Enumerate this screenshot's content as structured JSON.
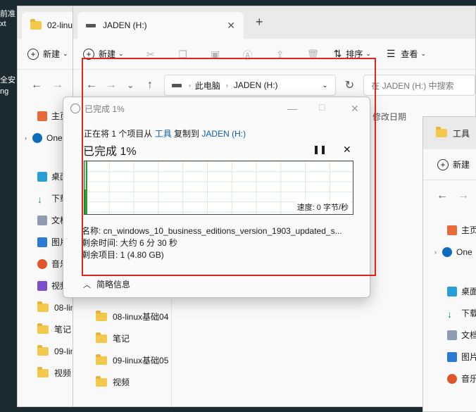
{
  "desktop": {
    "lines": [
      "前准",
      "xt",
      "",
      "",
      "",
      "",
      "",
      "",
      "",
      "",
      "全安",
      "ng"
    ]
  },
  "win_left": {
    "tab_title": "02-linu",
    "new_label": "新建",
    "sidebar": [
      {
        "label": "主页",
        "icon": "home-icon"
      },
      {
        "label": "One",
        "icon": "cloud-icon"
      },
      {
        "label": "桌面",
        "icon": "desktop-icon"
      },
      {
        "label": "下载",
        "icon": "download-icon"
      },
      {
        "label": "文档",
        "icon": "document-icon"
      },
      {
        "label": "图片",
        "icon": "image-icon"
      },
      {
        "label": "音乐",
        "icon": "music-icon"
      },
      {
        "label": "视频",
        "icon": "video-icon"
      },
      {
        "label": "08-lin",
        "icon": "folder-icon"
      },
      {
        "label": "笔记",
        "icon": "folder-icon"
      },
      {
        "label": "09-lin",
        "icon": "folder-icon"
      },
      {
        "label": "视频",
        "icon": "folder-icon"
      }
    ]
  },
  "win_main": {
    "tab_title": "JADEN (H:)",
    "new_tab": "+",
    "toolbar": {
      "new_label": "新建",
      "sort_label": "排序",
      "view_label": "查看"
    },
    "breadcrumb": [
      "此电脑",
      "JADEN (H:)"
    ],
    "search_placeholder": "在 JADEN (H:) 中搜索",
    "column_modified": "修改日期",
    "list": [
      "08-linux基础04",
      "笔记",
      "09-linux基础05",
      "视频"
    ]
  },
  "win_right": {
    "tab_title": "工具",
    "new_label": "新建",
    "sidebar": [
      {
        "label": "主页"
      },
      {
        "label": "One"
      },
      {
        "label": "桌面"
      },
      {
        "label": "下载"
      },
      {
        "label": "文档"
      },
      {
        "label": "图片"
      },
      {
        "label": "音乐"
      }
    ]
  },
  "dialog": {
    "title": "已完成 1%",
    "copy_prefix": "正在将 1 个项目从",
    "source": "工具",
    "copy_mid": "复制到",
    "dest": "JADEN (H:)",
    "percent_label": "已完成 1%",
    "progress": 0.01,
    "speed": "速度: 0 字节/秒",
    "name_line": "名称: cn_windows_10_business_editions_version_1903_updated_s...",
    "time_line": "剩余时间: 大约 6 分 30 秒",
    "items_line": "剩余项目: 1 (4.80 GB)",
    "less_details": "简略信息"
  }
}
